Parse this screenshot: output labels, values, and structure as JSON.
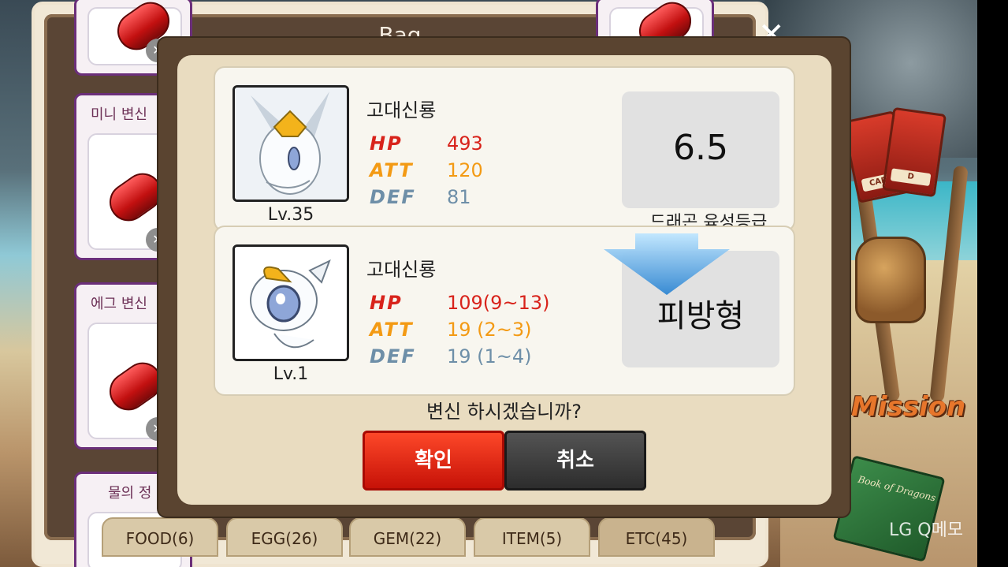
{
  "bag": {
    "title": "Bag",
    "close_symbol": "✕",
    "slots": [
      {
        "name": ""
      },
      {
        "name": "미니 변신"
      },
      {
        "name": "에그 변신"
      },
      {
        "name": "물의 정"
      }
    ],
    "right_slots": [
      {
        "name": ""
      }
    ],
    "slot_x_symbol": "✕",
    "tabs": [
      "FOOD(6)",
      "EGG(26)",
      "GEM(22)",
      "ITEM(5)",
      "ETC(45)"
    ],
    "active_tab": "ETC(45)"
  },
  "background": {
    "card_label": "CARD",
    "card_label_2": "D",
    "mission_text": "Mission",
    "book_text": "Book of Dragons",
    "watermark": "LG Q메모"
  },
  "dialog": {
    "current": {
      "name": "고대신룡",
      "level": "Lv.35",
      "stats": [
        {
          "label": "HP",
          "value": "493"
        },
        {
          "label": "ATT",
          "value": "120"
        },
        {
          "label": "DEF",
          "value": "81"
        }
      ],
      "badge_value": "6.5",
      "badge_caption": "드래곤 육성등급"
    },
    "next": {
      "name": "고대신룡",
      "level": "Lv.1",
      "stats": [
        {
          "label": "HP",
          "value": "109(9~13)"
        },
        {
          "label": "ATT",
          "value": "19 (2~3)"
        },
        {
          "label": "DEF",
          "value": "19 (1~4)"
        }
      ],
      "badge_value": "피방형"
    },
    "question": "변신 하시겠습니까?",
    "confirm_label": "확인",
    "cancel_label": "취소"
  }
}
